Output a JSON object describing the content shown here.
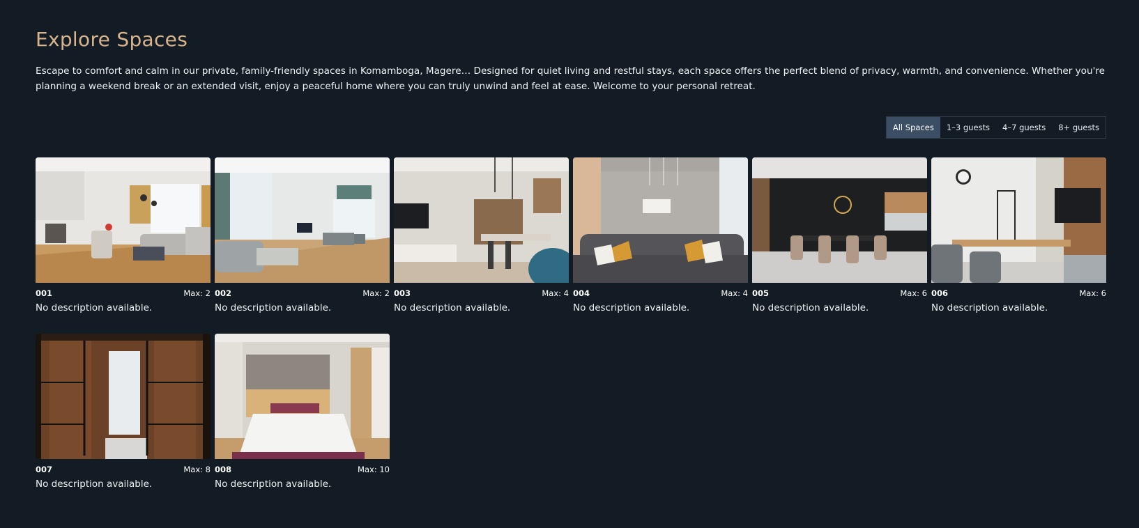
{
  "header": {
    "title": "Explore Spaces",
    "intro": "Escape to comfort and calm in our private, family-friendly spaces in Komamboga, Magere… Designed for quiet living and restful stays, each space offers the perfect blend of privacy, warmth, and convenience. Whether you're planning a weekend break or an extended visit, enjoy a peaceful home where you can truly unwind and feel at ease. Welcome to your personal retreat."
  },
  "filters": [
    {
      "label": "All Spaces",
      "active": true
    },
    {
      "label": "1–3 guests",
      "active": false
    },
    {
      "label": "4–7 guests",
      "active": false
    },
    {
      "label": "8+ guests",
      "active": false
    }
  ],
  "spaces": [
    {
      "id": "001",
      "max": "Max: 2",
      "description": "No description available.",
      "photo": "bright-living-room-with-kitchen"
    },
    {
      "id": "002",
      "max": "Max: 2",
      "description": "No description available.",
      "photo": "living-room-with-dining-table"
    },
    {
      "id": "003",
      "max": "Max: 4",
      "description": "No description available.",
      "photo": "open-plan-kitchen-with-bar-stools"
    },
    {
      "id": "004",
      "max": "Max: 4",
      "description": "No description available.",
      "photo": "grey-sofa-with-pendant-lights"
    },
    {
      "id": "005",
      "max": "Max: 6",
      "description": "No description available.",
      "photo": "dark-kitchen-dining-area"
    },
    {
      "id": "006",
      "max": "Max: 6",
      "description": "No description available.",
      "photo": "workspace-with-tv-and-chairs"
    },
    {
      "id": "007",
      "max": "Max: 8",
      "description": "No description available.",
      "photo": "walk-in-wardrobe"
    },
    {
      "id": "008",
      "max": "Max: 10",
      "description": "No description available.",
      "photo": "bedroom-with-mattress"
    }
  ],
  "colors": {
    "background": "#131c24",
    "title": "#d7b48d",
    "active_filter": "#3b4e63"
  }
}
